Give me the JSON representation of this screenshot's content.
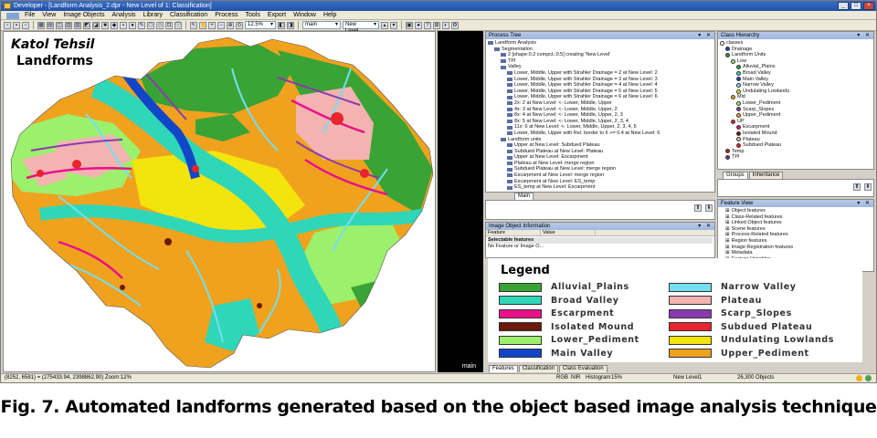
{
  "window": {
    "title": "Developer - [Landform Analysis_2.dpr - New Level of 1: Classification]"
  },
  "menu": [
    "File",
    "View",
    "Image Objects",
    "Analysis",
    "Library",
    "Classification",
    "Process",
    "Tools",
    "Export",
    "Window",
    "Help"
  ],
  "toolbar": {
    "zoom": "12.5%",
    "layer": "main",
    "level": "New Level"
  },
  "map": {
    "title_line1": "Katol Tehsil",
    "title_line2": "Landforms",
    "view_label": "main",
    "colors": {
      "alluvial_plains": "#3aa335",
      "broad_valley": "#2fd6b8",
      "escarpment": "#e8118a",
      "isolated_mound": "#6b1b0c",
      "lower_pediment": "#9cf06c",
      "main_valley": "#1246c8",
      "narrow_valley": "#74dff0",
      "plateau": "#f3b3b1",
      "scarp_slopes": "#8a3ab0",
      "subdued_plateau": "#e8242c",
      "undulating_lowlands": "#f2e40c",
      "upper_pediment": "#f0a21e"
    }
  },
  "status": {
    "coords": "(8252, 6581) = (275433.94, 2398862.90)  Zoom:12%",
    "rgb": "RGB",
    "nir": "NIR",
    "histogram": "Histogram",
    "hist_pct": "15%",
    "level": "New Level1",
    "objects": "26,300 Objects"
  },
  "process_tree": {
    "title": "Process Tree",
    "rows": [
      "Landform Analysis",
      "Segmentation",
      "2 [shape:0.2 compct.:0.5] creating 'New Level'",
      "TPI",
      "Valley",
      "Lower, Middle, Upper with Strahler Drainage = 2  at  New Level: 2",
      "Lower, Middle, Upper with Strahler Drainage = 3  at  New Level: 3",
      "Lower, Middle, Upper with Strahler Drainage = 4  at  New Level: 4",
      "Lower, Middle, Upper with Strahler Drainage = 5  at  New Level: 5",
      "Lower, Middle, Upper with Strahler Drainage = 6  at  New Level: 6",
      "2x: 2 at  New Level: <- Lower, Middle, Upper",
      "4x: 3 at  New Level: <- Lower, Middle, Upper, 2",
      "8x: 4 at  New Level: <- Lower, Middle, Upper, 2, 3",
      "8x: 5 at  New Level: <- Lower, Middle, Upper, 2, 3, 4",
      "11x: 6 at  New Level: <- Lower, Middle, Upper, 2, 3, 4, 5",
      "Lower, Middle, Upper with Rel. border to 6 >= 0.4  at  New Level: 6",
      "Landform units",
      "Upper at  New Level: Subdued Plateau",
      "Subdued Plateau at  New Level: Plateau",
      "Upper at  New Level: Escarpment",
      "Plateau at  New Level: merge region",
      "Subdued Plateau at  New Level: merge region",
      "Escarpment at  New Level: merge region",
      "Escarpment at  New Level: ES_temp",
      "ES_temp at  New Level: Escarpment"
    ],
    "tab": "Main"
  },
  "class_hierarchy": {
    "title": "Class Hierarchy",
    "rows": [
      {
        "label": "classes",
        "color": ""
      },
      {
        "label": "Drainage",
        "color": "#1f3fbf"
      },
      {
        "label": "Landform Units",
        "color": "#2c9b38"
      },
      {
        "label": "Low",
        "color": "#9cf06c"
      },
      {
        "label": "Alluvial_Plains",
        "color": "#3aa335"
      },
      {
        "label": "Broad Valley",
        "color": "#2fd6b8"
      },
      {
        "label": "Main Valley",
        "color": "#1246c8"
      },
      {
        "label": "Narrow Valley",
        "color": "#74dff0"
      },
      {
        "label": "Undulating Lowlands",
        "color": "#f2e40c"
      },
      {
        "label": "Mid",
        "color": "#f0a21e"
      },
      {
        "label": "Lower_Pediment",
        "color": "#9cf06c"
      },
      {
        "label": "Scarp_Slopes",
        "color": "#8a3ab0"
      },
      {
        "label": "Upper_Pediment",
        "color": "#f0a21e"
      },
      {
        "label": "UP",
        "color": "#e8242c"
      },
      {
        "label": "Escarpment",
        "color": "#e8118a"
      },
      {
        "label": "Isolated Mound",
        "color": "#6b1b0c"
      },
      {
        "label": "Plateau",
        "color": "#f3b3b1"
      },
      {
        "label": "Subdued Plateau",
        "color": "#e8242c"
      },
      {
        "label": "Temp",
        "color": "#c82020"
      },
      {
        "label": "TPI",
        "color": "#7030a0"
      }
    ],
    "tabs": [
      "Groups",
      "Inheritance"
    ]
  },
  "image_object_info": {
    "title": "Image Object Information",
    "col_feature": "Feature",
    "col_value": "Value",
    "rows": [
      "Selectable features",
      "No Feature or Image O..."
    ]
  },
  "feature_view": {
    "title": "Feature View",
    "rows": [
      "Object features",
      "Class-Related features",
      "Linked Object features",
      "Scene features",
      "Process-Related features",
      "Region features",
      "Image Registration features",
      "Metadata",
      "Feature Variables"
    ]
  },
  "bottom_tabs": [
    "Features",
    "Classification",
    "Class Evaluation"
  ],
  "legend": {
    "title": "Legend",
    "items": [
      {
        "label": "Alluvial_Plains",
        "color": "#3aa335"
      },
      {
        "label": "Narrow Valley",
        "color": "#74dff0"
      },
      {
        "label": "Broad Valley",
        "color": "#2fd6b8"
      },
      {
        "label": "Plateau",
        "color": "#f3b3b1"
      },
      {
        "label": "Escarpment",
        "color": "#e8118a"
      },
      {
        "label": "Scarp_Slopes",
        "color": "#8a3ab0"
      },
      {
        "label": "Isolated Mound",
        "color": "#6b1b0c"
      },
      {
        "label": "Subdued Plateau",
        "color": "#e8242c"
      },
      {
        "label": "Lower_Pediment",
        "color": "#9cf06c"
      },
      {
        "label": "Undulating Lowlands",
        "color": "#f2e40c"
      },
      {
        "label": "Main Valley",
        "color": "#1246c8"
      },
      {
        "label": "Upper_Pediment",
        "color": "#f0a21e"
      }
    ]
  },
  "caption": "Fig. 7. Automated landforms generated based on the object based image analysis technique"
}
